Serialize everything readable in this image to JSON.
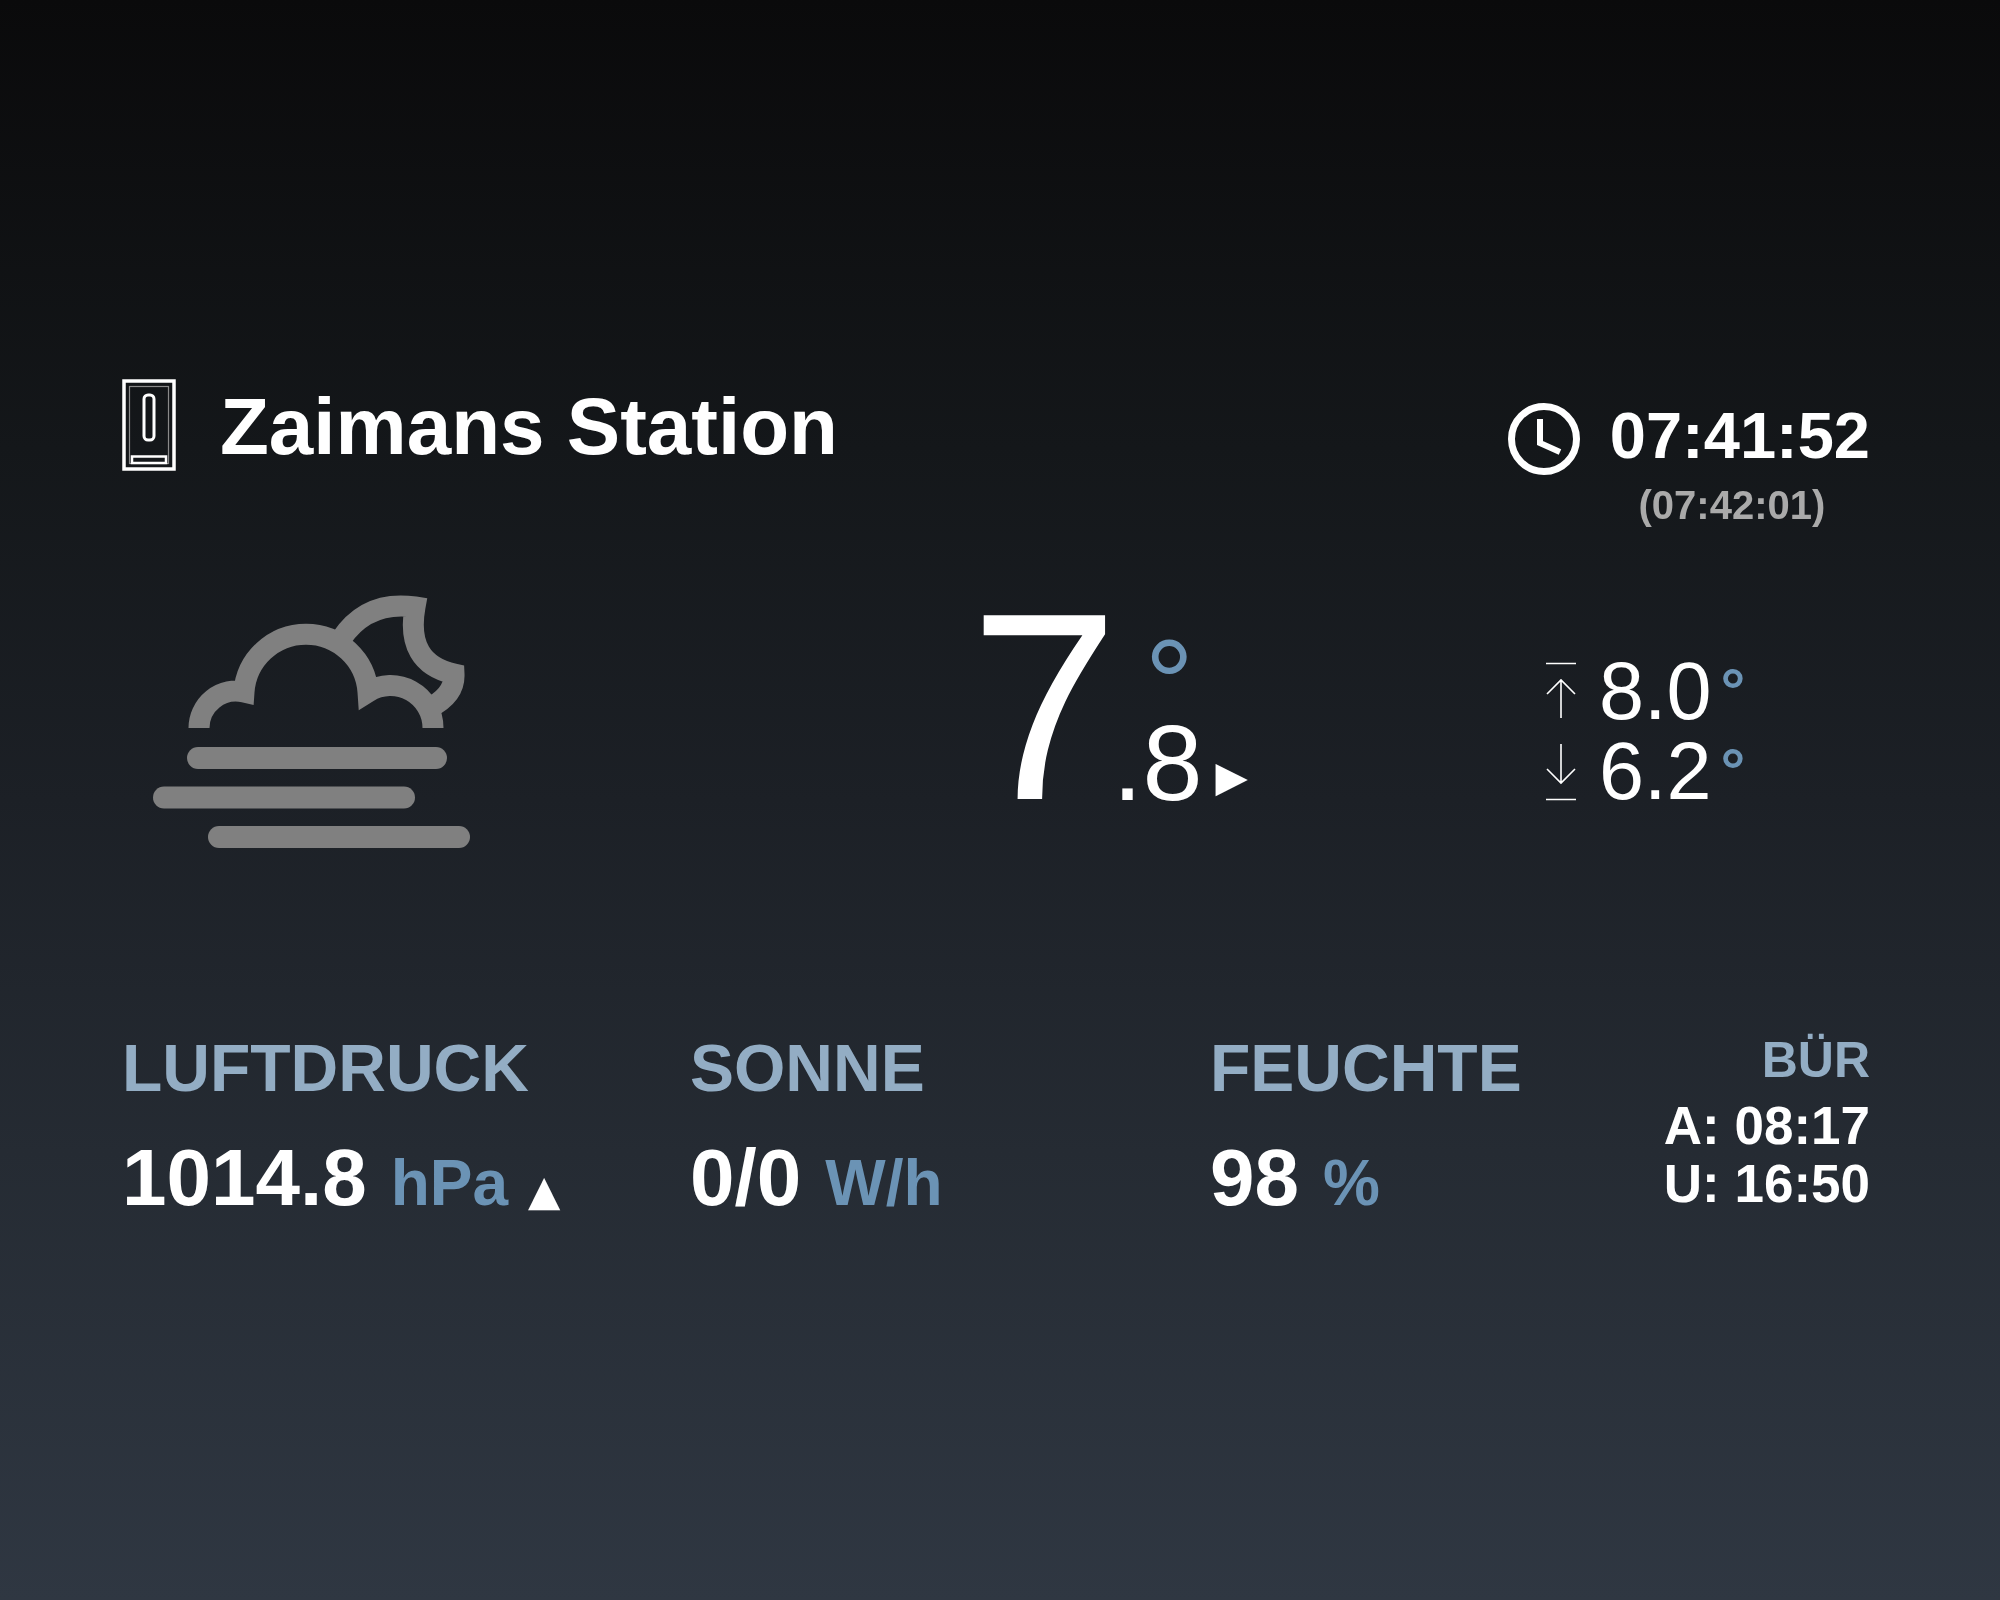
{
  "station": {
    "name": "Zaimans Station"
  },
  "clock": {
    "time": "07:41:52",
    "updated": "(07:42:01)"
  },
  "temperature": {
    "whole": "7",
    "decimal": ".8",
    "unit": "°",
    "trend": "▶"
  },
  "range": [
    {
      "kind": "high",
      "value": "8.0",
      "unit": "°"
    },
    {
      "kind": "low",
      "value": "6.2",
      "unit": "°"
    }
  ],
  "readings": [
    {
      "label": "LUFTDRUCK",
      "value": "1014.8",
      "unit": "hPa",
      "trend": "▲"
    },
    {
      "label": "SONNE",
      "value": "0/0",
      "unit": "W/h"
    },
    {
      "label": "FEUCHTE",
      "value": "98",
      "unit": "%"
    }
  ],
  "sun": {
    "label": "BÜR",
    "rise": "A: 08:17",
    "set": "U: 16:50"
  }
}
